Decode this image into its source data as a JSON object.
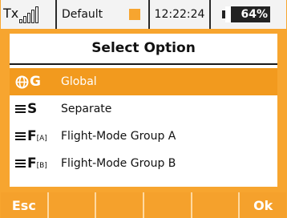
{
  "status_bar": {
    "tx_label": "Tx",
    "model_name": "Default",
    "time": "12:22:24",
    "battery_percent": "64%",
    "battery_level": 0.64
  },
  "dialog": {
    "title": "Select Option",
    "options": [
      {
        "icon": "global-icon",
        "icon_text": "G",
        "label": "Global",
        "selected": true
      },
      {
        "icon": "separate-icon",
        "icon_text": "S",
        "label": "Separate",
        "selected": false
      },
      {
        "icon": "flight-mode-group-icon",
        "icon_text": "F",
        "icon_sub": "[A]",
        "label": "Flight-Mode Group A",
        "selected": false
      },
      {
        "icon": "flight-mode-group-icon",
        "icon_text": "F",
        "icon_sub": "[B]",
        "label": "Flight-Mode Group B",
        "selected": false
      }
    ]
  },
  "softkeys": [
    "Esc",
    "",
    "",
    "",
    "",
    "Ok"
  ],
  "colors": {
    "accent": "#f7a52f",
    "selected_row": "#f29a1e",
    "text": "#111111"
  }
}
